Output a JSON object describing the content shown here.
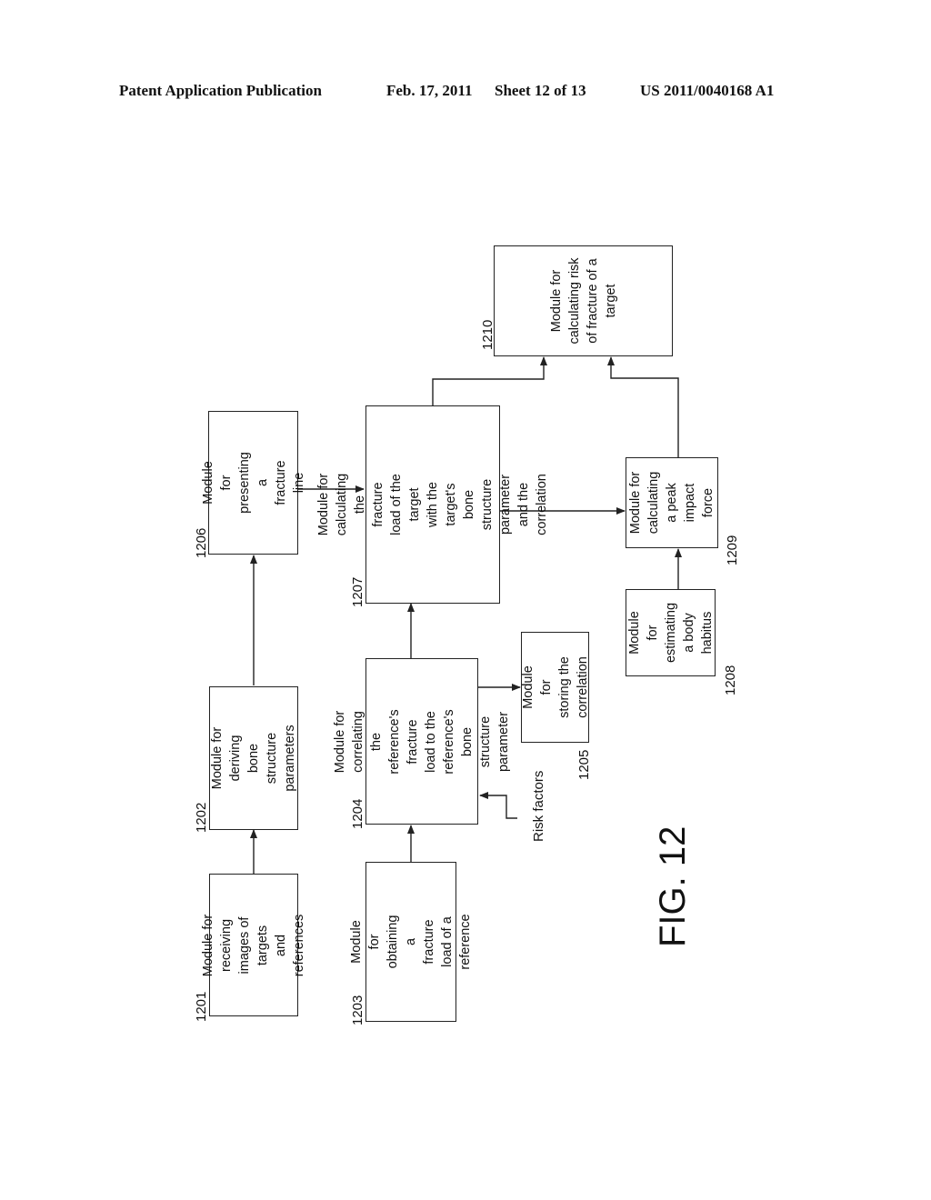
{
  "header": {
    "publication": "Patent Application Publication",
    "date": "Feb. 17, 2011",
    "sheet": "Sheet 12 of 13",
    "number": "US 2011/0040168 A1"
  },
  "figure_label": "FIG. 12",
  "modules": [
    {
      "id": "1201",
      "text": "Module for receiving\nimages of targets\nand references"
    },
    {
      "id": "1202",
      "text": "Module for deriving\nbone structure\nparameters"
    },
    {
      "id": "1203",
      "text": "Module for obtaining a\nfracture load of a\nreference"
    },
    {
      "id": "1204",
      "text": "Module for correlating\nthe reference's fracture\nload to the reference's\nbone structure\nparameter"
    },
    {
      "id": "1205",
      "text": "Module for\nstoring the\ncorrelation"
    },
    {
      "id": "1206",
      "text": "Module for\npresenting a\nfracture line"
    },
    {
      "id": "1207",
      "text": "Module for calculating the\nfracture load of the target\nwith the target's bone\nstructure parameter and the\ncorrelation"
    },
    {
      "id": "1208",
      "text": "Module for\nestimating\na body\nhabitus"
    },
    {
      "id": "1209",
      "text": "Module for\ncalculating\na peak\nimpact force"
    },
    {
      "id": "1210",
      "text": "Module for\ncalculating risk\nof fracture of a\ntarget"
    }
  ],
  "inputs": {
    "risk_factors": "Risk factors"
  }
}
